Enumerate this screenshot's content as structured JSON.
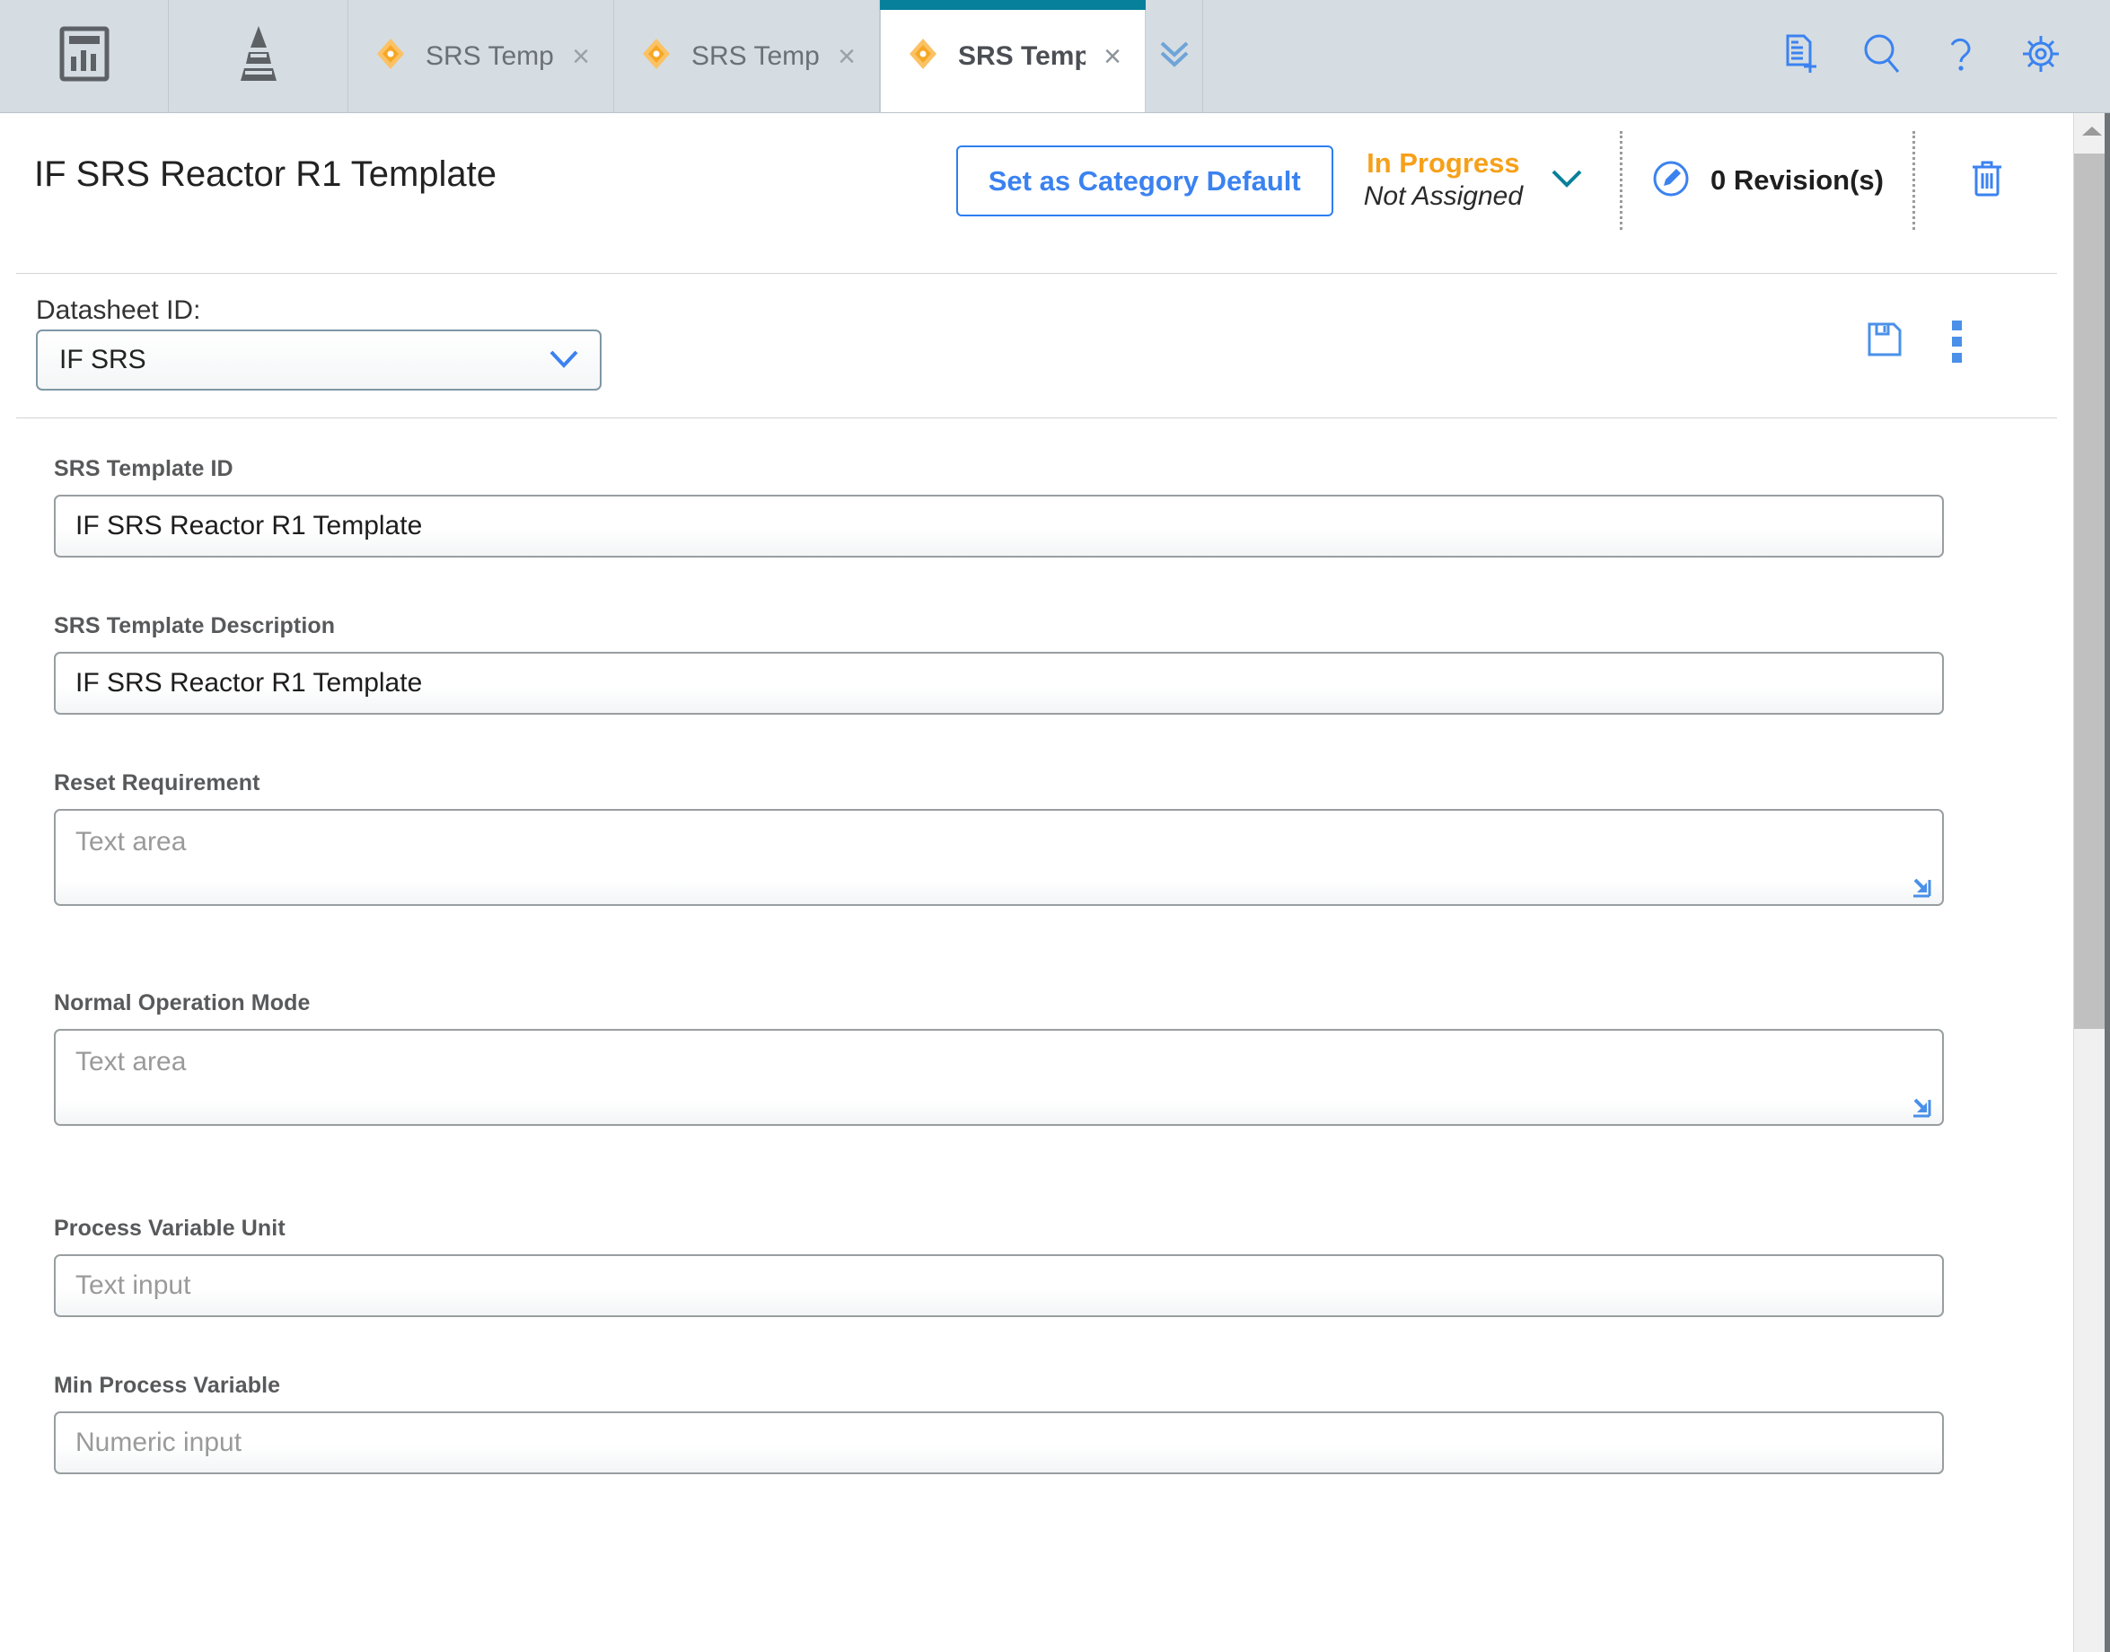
{
  "tabbar": {
    "app_icon_name": "report-dashboard-icon",
    "hierarchy_icon_name": "hierarchy-pyramid-icon",
    "tabs": [
      {
        "label": "SRS Template",
        "icon": "diamond-icon",
        "close": "×",
        "active": false
      },
      {
        "label": "SRS Template",
        "icon": "diamond-icon",
        "close": "×",
        "active": false
      },
      {
        "label": "SRS Template",
        "icon": "diamond-icon",
        "close": "×",
        "active": true
      }
    ],
    "more_tabs_icon": "double-chevron-down-icon",
    "tools": [
      {
        "name": "new-document-icon"
      },
      {
        "name": "search-icon"
      },
      {
        "name": "help-icon"
      },
      {
        "name": "settings-gear-icon"
      }
    ],
    "active_tab_accent": "#07809c"
  },
  "header": {
    "title": "IF SRS Reactor R1 Template",
    "set_default_button": "Set as Category Default",
    "status": "In Progress",
    "assignment": "Not Assigned",
    "status_chevron_icon": "chevron-down-icon",
    "status_color": "#f6a01a",
    "revisions_label": "0 Revision(s)",
    "revisions_icon": "pencil-circle-icon",
    "delete_icon": "trash-icon",
    "accent_color": "#3b82f0"
  },
  "datasheet": {
    "label": "Datasheet ID:",
    "value": "IF SRS",
    "chevron_icon": "chevron-down-icon",
    "save_icon": "floppy-save-icon",
    "more_icon": "kebab-menu-icon"
  },
  "form": {
    "fields": [
      {
        "label": "SRS Template ID",
        "value": "IF SRS Reactor R1 Template",
        "type": "text"
      },
      {
        "label": "SRS Template Description",
        "value": "IF SRS Reactor R1 Template",
        "type": "text"
      },
      {
        "label": "Reset Requirement",
        "placeholder": "Text area",
        "type": "textarea"
      },
      {
        "label": "Normal Operation Mode",
        "placeholder": "Text area",
        "type": "textarea"
      },
      {
        "label": "Process Variable Unit",
        "placeholder": "Text input",
        "type": "text-empty"
      },
      {
        "label": "Min Process Variable",
        "placeholder": "Numeric input",
        "type": "number-empty"
      }
    ],
    "resize_icon": "expand-textarea-icon"
  },
  "scrollbar": {
    "up_arrow_icon": "scroll-up-arrow-icon"
  }
}
